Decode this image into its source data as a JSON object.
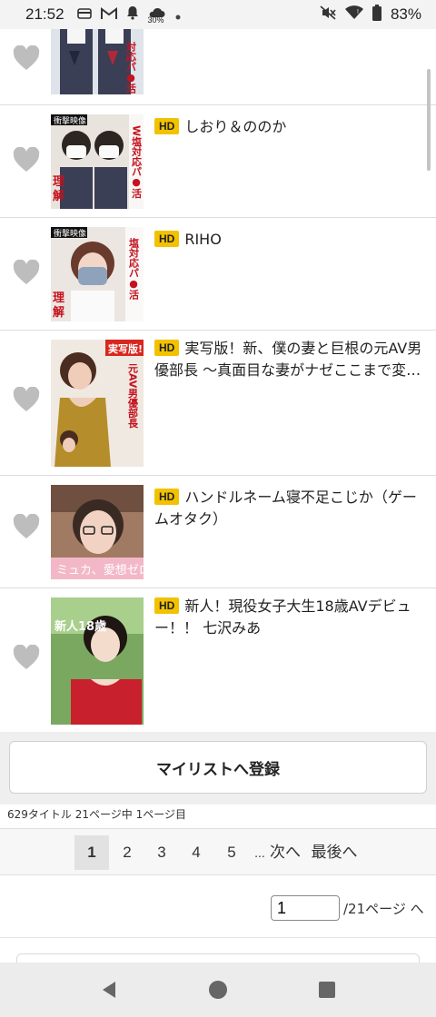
{
  "status": {
    "time": "21:52",
    "weather_pct": "30%",
    "battery_pct": "83%"
  },
  "items": [
    {
      "hd": "",
      "title": "",
      "thumb_text": "対応パ●活"
    },
    {
      "hd": "HD",
      "title": "しおり＆ののか",
      "thumb_text": "W塩対応パ●活"
    },
    {
      "hd": "HD",
      "title": "RIHO",
      "thumb_text": "塩対応パ●活"
    },
    {
      "hd": "HD",
      "title": "実写版！新、僕の妻と巨根の元AV男優部長 〜真面目な妻がナゼここまで変えら...",
      "thumb_text": "元AV男優部長"
    },
    {
      "hd": "HD",
      "title": "ハンドルネーム寝不足こじか（ゲームオタク）",
      "thumb_text": "ミュカ、愛想ゼロ"
    },
    {
      "hd": "HD",
      "title": "新人！現役女子大生18歳AVデビュー！！ 七沢みあ",
      "thumb_text": "新人18歳"
    }
  ],
  "actions": {
    "mylist_label": "マイリストへ登録"
  },
  "summary": {
    "count_text": "629タイトル 21ページ中 1ページ目"
  },
  "pagination": {
    "pages": [
      "1",
      "2",
      "3",
      "4",
      "5"
    ],
    "ellipsis": "...",
    "next": "次へ",
    "last": "最後へ",
    "current": "1"
  },
  "page_jump": {
    "value": "1",
    "suffix": "/21ページ へ"
  },
  "colors": {
    "hd_badge": "#f2c200",
    "heart": "#bdbdbd"
  }
}
